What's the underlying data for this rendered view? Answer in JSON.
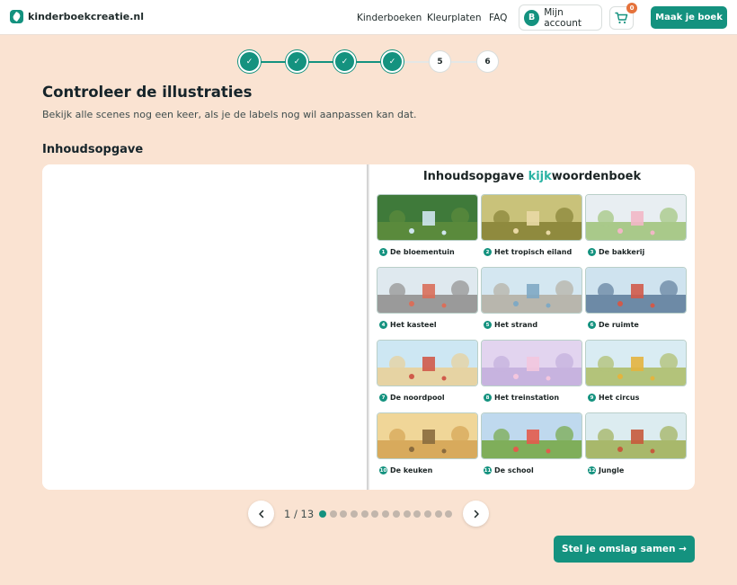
{
  "header": {
    "logo_text": "kinderboekcreatie.nl",
    "nav": [
      "Kinderboeken",
      "Kleurplaten",
      "FAQ"
    ],
    "account_initial": "B",
    "account_label": "Mijn account",
    "cart_count": "0",
    "cta_label": "Maak je boek"
  },
  "stepper": {
    "steps": [
      {
        "label": "✓",
        "state": "done"
      },
      {
        "label": "✓",
        "state": "done"
      },
      {
        "label": "✓",
        "state": "done"
      },
      {
        "label": "✓",
        "state": "done"
      },
      {
        "label": "5",
        "state": "todo"
      },
      {
        "label": "6",
        "state": "todo"
      }
    ]
  },
  "page": {
    "title": "Controleer de illustraties",
    "subtitle": "Bekijk alle scenes nog een keer, als je de labels nog wil aanpassen kan dat.",
    "section_title": "Inhoudsopgave"
  },
  "book": {
    "title_before": "Inhoudsopgave ",
    "title_accent": "kijk",
    "title_after": "woordenboek",
    "scenes": [
      {
        "num": "1",
        "label": "De bloementuin",
        "sky": "#3f7a3a",
        "ground": "#5a8a3c",
        "accent": "#cfe6ef"
      },
      {
        "num": "2",
        "label": "Het tropisch eiland",
        "sky": "#c9c27a",
        "ground": "#8f8a3e",
        "accent": "#e9d9a5"
      },
      {
        "num": "3",
        "label": "De bakkerij",
        "sky": "#e8eef2",
        "ground": "#a9c98a",
        "accent": "#f2b7c6"
      },
      {
        "num": "4",
        "label": "Het kasteel",
        "sky": "#dfe9ef",
        "ground": "#9a9a9a",
        "accent": "#d96f5a"
      },
      {
        "num": "5",
        "label": "Het strand",
        "sky": "#d4e7f1",
        "ground": "#b8b6ad",
        "accent": "#7fa9c4"
      },
      {
        "num": "6",
        "label": "De ruimte",
        "sky": "#cfe3ef",
        "ground": "#6d8aa6",
        "accent": "#d05a4a"
      },
      {
        "num": "7",
        "label": "De noordpool",
        "sky": "#cde7f3",
        "ground": "#e6d3a3",
        "accent": "#d05a4a"
      },
      {
        "num": "8",
        "label": "Het treinstation",
        "sky": "#e2d4ef",
        "ground": "#c7b3df",
        "accent": "#f3c6de"
      },
      {
        "num": "9",
        "label": "Het circus",
        "sky": "#d9ecf3",
        "ground": "#b3c37a",
        "accent": "#e3b43f"
      },
      {
        "num": "10",
        "label": "De keuken",
        "sky": "#f0d698",
        "ground": "#d8aa5c",
        "accent": "#8a6b3e"
      },
      {
        "num": "11",
        "label": "De school",
        "sky": "#bfd9ee",
        "ground": "#7fae5a",
        "accent": "#e35b4c"
      },
      {
        "num": "12",
        "label": "Jungle",
        "sky": "#dcecf0",
        "ground": "#a8b86b",
        "accent": "#c65a3c"
      }
    ]
  },
  "pager": {
    "count_label": "1 / 13",
    "total": 13,
    "current": 1
  },
  "footer": {
    "next_label": "Stel je omslag samen →"
  },
  "colors": {
    "brand": "#14927f",
    "background": "#fae3d2",
    "badge": "#e5723b"
  }
}
